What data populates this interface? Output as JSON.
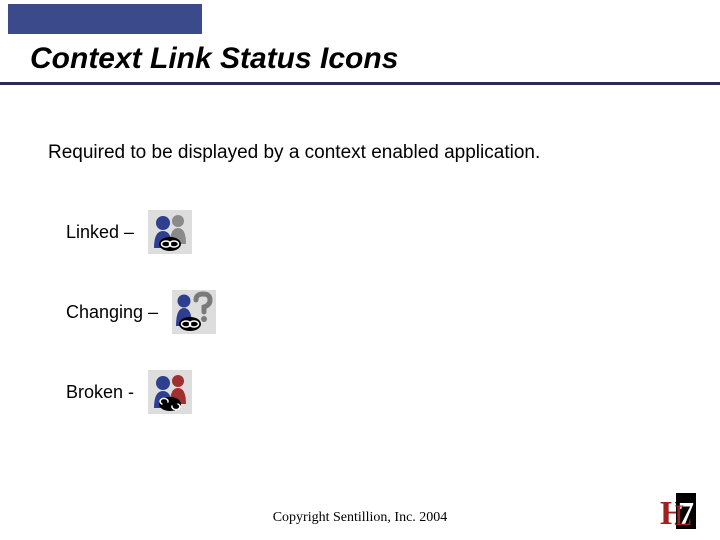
{
  "title": "Context Link Status Icons",
  "subtitle": "Required to be displayed by a context enabled application.",
  "statuses": [
    {
      "label": "Linked – ",
      "icon": "linked"
    },
    {
      "label": "Changing – ",
      "icon": "changing"
    },
    {
      "label": "Broken - ",
      "icon": "broken"
    }
  ],
  "footer": "Copyright Sentillion, Inc. 2004",
  "logo": "HL7",
  "colors": {
    "bar": "#3a4a8a",
    "rule": "#2a2a5a",
    "person1": "#2f3f8f",
    "person2_gray": "#8a8a8a",
    "person2_red": "#a03030",
    "hl7_red": "#a02020"
  }
}
